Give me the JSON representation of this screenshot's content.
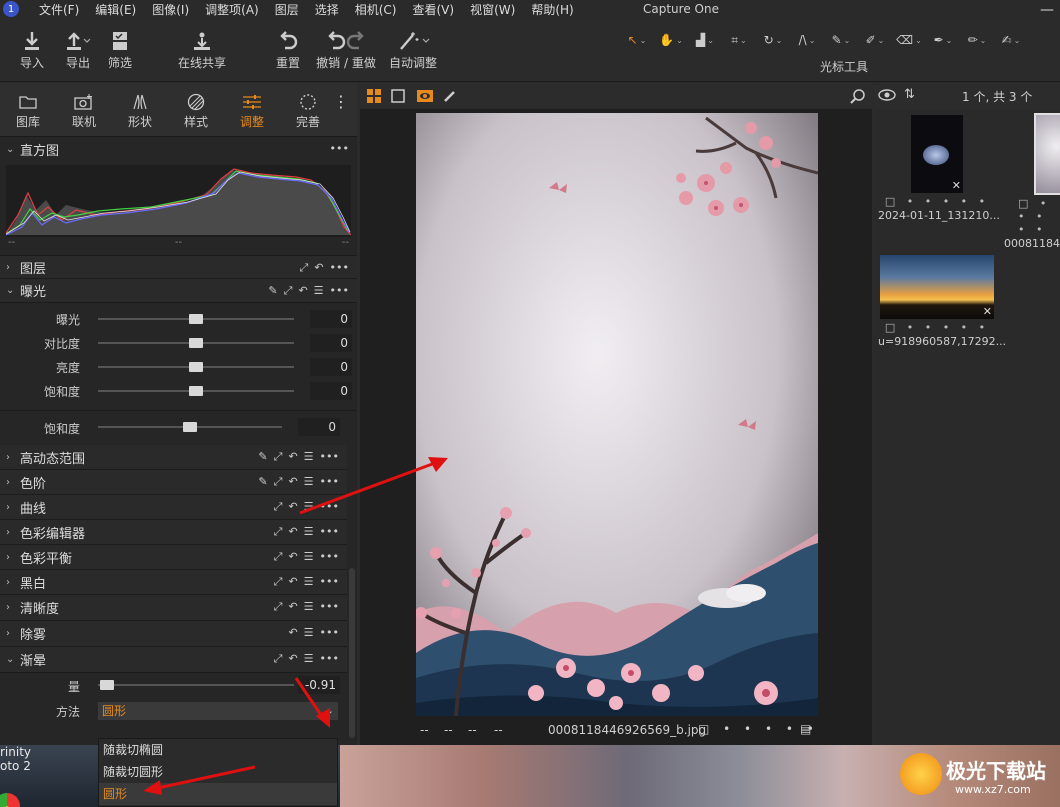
{
  "menubar": {
    "items": [
      "文件(F)",
      "编辑(E)",
      "图像(I)",
      "调整项(A)",
      "图层",
      "选择",
      "相机(C)",
      "查看(V)",
      "视窗(W)",
      "帮助(H)"
    ],
    "app_title": "Capture One",
    "minimize": "—"
  },
  "toolbar": {
    "import": "导入",
    "export": "导出",
    "filter": "筛选",
    "share": "在线共享",
    "reset": "重置",
    "undo_redo": "撤销 / 重做",
    "auto_adjust": "自动调整",
    "cursor_tools_label": "光标工具"
  },
  "tooltabs": [
    "图库",
    "联机",
    "形状",
    "样式",
    "调整",
    "完善"
  ],
  "sections": {
    "histogram": "直方图",
    "histogram_labels": [
      "--",
      "--",
      "--"
    ],
    "layers": "图层",
    "exposure": "曝光",
    "exposure_sliders": [
      {
        "label": "曝光",
        "value": "0"
      },
      {
        "label": "对比度",
        "value": "0"
      },
      {
        "label": "亮度",
        "value": "0"
      },
      {
        "label": "饱和度",
        "value": "0"
      }
    ],
    "saturation2": {
      "label": "饱和度",
      "value": "0"
    },
    "list": [
      "高动态范围",
      "色阶",
      "曲线",
      "色彩编辑器",
      "色彩平衡",
      "黑白",
      "清晰度",
      "除雾"
    ],
    "vignette": "渐晕",
    "amount_label": "量",
    "amount_value": "-0.91",
    "method_label": "方法",
    "method_value": "圆形"
  },
  "dropdown": {
    "options": [
      "随裁切椭圆",
      "随裁切圆形",
      "圆形"
    ],
    "selected_index": 2
  },
  "viewer": {
    "filename": "0008118446926569_b.jpg",
    "placeholders": [
      "--",
      "--",
      "--",
      "--"
    ]
  },
  "browser": {
    "count": "1 个, 共 3 个",
    "thumbs": [
      {
        "name": "2024-01-11_131210..."
      },
      {
        "name": "000811844..."
      },
      {
        "name": "u=918960587,17292..."
      }
    ],
    "dots": "□ • • • • •"
  },
  "background_text": [
    "rinity",
    "oto 2"
  ],
  "watermark": {
    "cn": "极光下载站",
    "url": "www.xz7.com"
  },
  "colors": {
    "accent": "#e58a1f",
    "arrow": "#e01010"
  }
}
